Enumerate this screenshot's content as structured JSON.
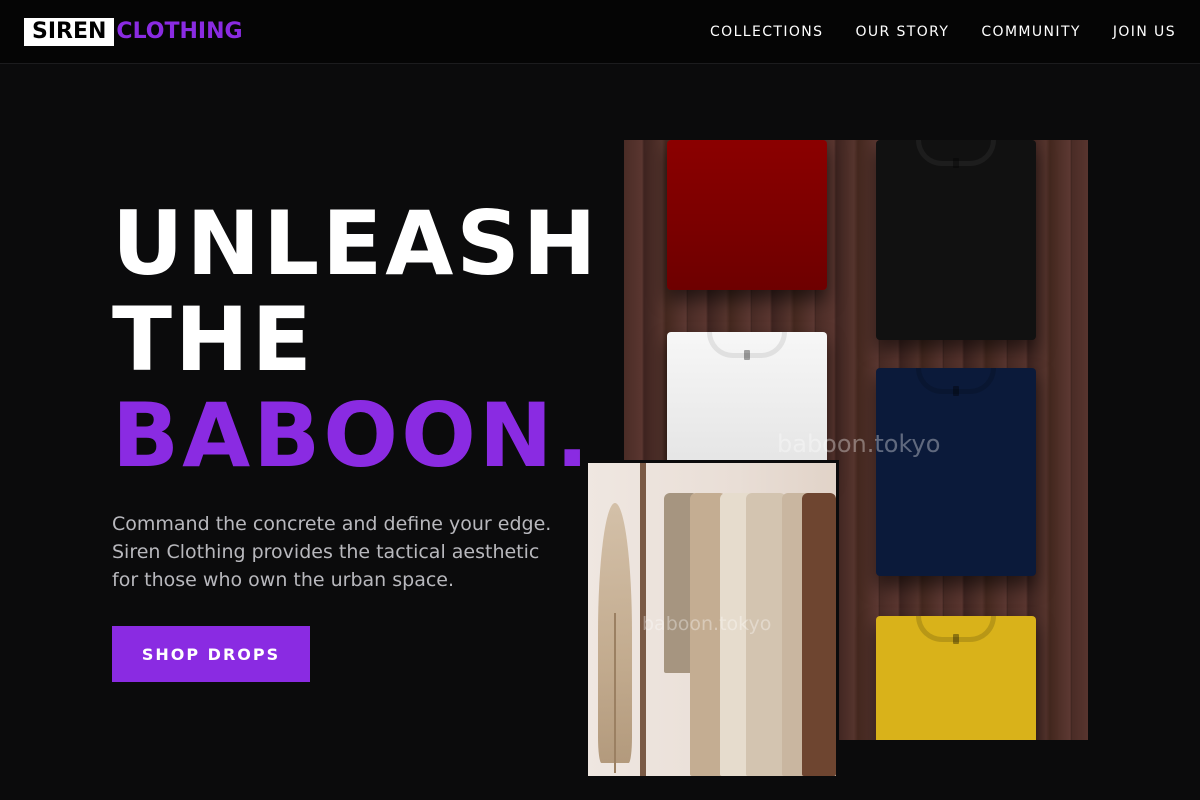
{
  "brand": {
    "logo_box_text": "SIREN",
    "logo_text": "CLOTHING",
    "accent_color": "#8a2be2"
  },
  "nav": {
    "items": [
      {
        "label": "COLLECTIONS"
      },
      {
        "label": "OUR STORY"
      },
      {
        "label": "COMMUNITY"
      },
      {
        "label": "JOIN US"
      }
    ]
  },
  "hero": {
    "title_lines": [
      "UNLEASH",
      "THE",
      "BABOON."
    ],
    "description_lines": [
      "Command the concrete and define your edge.",
      "Siren Clothing provides the tactical aesthetic",
      "for those who own the urban space."
    ],
    "cta_label": "SHOP DROPS"
  },
  "images": {
    "main_watermark": "baboon.tokyo",
    "rack_watermark": "baboon.tokyo"
  }
}
